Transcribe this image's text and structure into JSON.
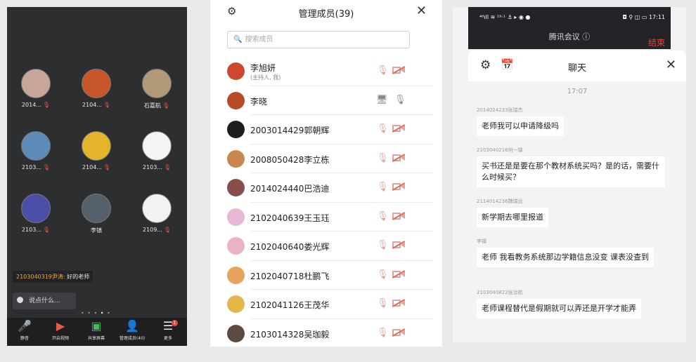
{
  "panel1": {
    "tiles": [
      {
        "name": "2014...",
        "avatar_color": "#c8a79a"
      },
      {
        "name": "2104...",
        "avatar_color": "#c7562b"
      },
      {
        "name": "石嘉航",
        "avatar_color": "#b29a78"
      },
      {
        "name": "2103...",
        "avatar_color": "#5e8ab8"
      },
      {
        "name": "2104...",
        "avatar_color": "#e4b52a"
      },
      {
        "name": "2103...",
        "avatar_color": "#f4f4f4"
      },
      {
        "name": "2103...",
        "avatar_color": "#4c4fa8"
      },
      {
        "name": "李镇",
        "avatar_color": "#55606a"
      },
      {
        "name": "2109...",
        "avatar_color": "#f2f2f2"
      }
    ],
    "chat_sender": "2103040319尹涛:",
    "chat_text": " 好的老师",
    "say_placeholder": "说点什么...",
    "pager": "• • • ",
    "pager_active": "•",
    "pager_after": " •",
    "toolbar": {
      "mute": "静音",
      "video": "开启视频",
      "share": "共享屏幕",
      "members": "管理成员(40)",
      "more": "更多",
      "more_badge": "1"
    }
  },
  "panel2": {
    "title": "管理成员(39)",
    "search_placeholder": "搜索成员",
    "members": [
      {
        "name": "李旭妍",
        "sub": "(主持人, 我)",
        "avatar_color": "#d0472f"
      },
      {
        "name": "李晓",
        "sub": "",
        "avatar_color": "#b84a2a"
      },
      {
        "name": "2003014429郭朝辉",
        "sub": "",
        "avatar_color": "#1d1d1d"
      },
      {
        "name": "2008050428李立栋",
        "sub": "",
        "avatar_color": "#c9864e"
      },
      {
        "name": "2014024440巴浩迪",
        "sub": "",
        "avatar_color": "#8a4d4d"
      },
      {
        "name": "2102040639王玉珏",
        "sub": "",
        "avatar_color": "#e7b7d3"
      },
      {
        "name": "2102040640娄光辉",
        "sub": "",
        "avatar_color": "#e9b3c3"
      },
      {
        "name": "2102040718杜鹏飞",
        "sub": "",
        "avatar_color": "#e8a35c"
      },
      {
        "name": "2102041126王茂华",
        "sub": "",
        "avatar_color": "#e2b84a"
      },
      {
        "name": "2103014328吴珈毅",
        "sub": "",
        "avatar_color": "#5b4a3e"
      }
    ]
  },
  "panel3": {
    "status_left": "⁴⁶ıll ≋ ¹⁹·¹ ⚓ ▸ ◉ ●",
    "status_right": "◘ ⚲ ◫ ▭ 17:11",
    "meeting_title": "腾讯会议 ⓘ",
    "end_label": "结束",
    "chat_title": "聊天",
    "time": "17:07",
    "messages": [
      {
        "sender": "2014024233张瑞杰",
        "text": "老师我可以申请降级吗"
      },
      {
        "sender": "2103040216何一镇",
        "text": "买书还是是要在那个教材系统买吗？是的话，需要什么时候买？"
      },
      {
        "sender": "2114014236魏瑞远",
        "text": "新学期去哪里报道"
      },
      {
        "sender": "李镇",
        "text": "老师 我看教务系统那边学籍信息没变 课表没查到"
      },
      {
        "sender": "2103040822张治航",
        "text": "老师课程替代是假期就可以弄还是开学才能弄"
      }
    ]
  }
}
